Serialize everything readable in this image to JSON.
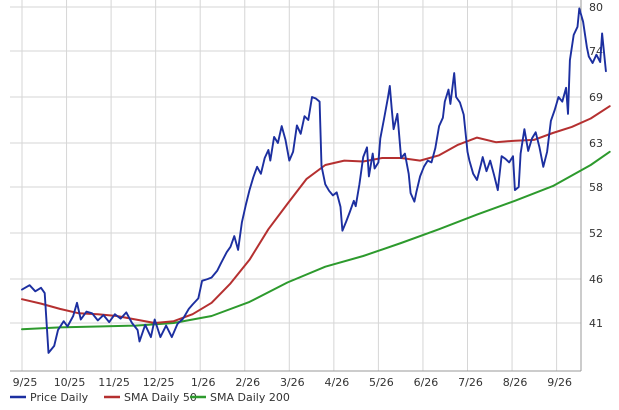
{
  "chart_data": {
    "type": "line",
    "x_ticks": [
      "9/25",
      "10/25",
      "11/25",
      "12/25",
      "1/26",
      "2/26",
      "3/26",
      "4/26",
      "5/26",
      "6/26",
      "7/26",
      "8/26",
      "9/26"
    ],
    "y_ticks": [
      80,
      74,
      69,
      63,
      58,
      52,
      46,
      41
    ],
    "ylim": [
      35,
      80
    ],
    "grid": true,
    "legend_position": "bottom-left",
    "series": [
      {
        "name": "Price Daily",
        "color": "#1c2fa0",
        "points": [
          [
            0,
            44.8
          ],
          [
            4,
            45.3
          ],
          [
            7,
            44.6
          ],
          [
            10,
            45.0
          ],
          [
            12,
            44.4
          ],
          [
            14,
            37.6
          ],
          [
            17,
            38.4
          ],
          [
            19,
            40.2
          ],
          [
            22,
            41.2
          ],
          [
            24,
            40.6
          ],
          [
            27,
            41.8
          ],
          [
            29,
            43.3
          ],
          [
            31,
            41.4
          ],
          [
            34,
            42.3
          ],
          [
            37,
            42.1
          ],
          [
            40,
            41.3
          ],
          [
            43,
            41.9
          ],
          [
            46,
            41.1
          ],
          [
            49,
            42.0
          ],
          [
            52,
            41.5
          ],
          [
            55,
            42.2
          ],
          [
            58,
            41.0
          ],
          [
            61,
            40.2
          ],
          [
            62,
            38.9
          ],
          [
            65,
            40.8
          ],
          [
            68,
            39.4
          ],
          [
            70,
            41.4
          ],
          [
            73,
            39.4
          ],
          [
            76,
            40.7
          ],
          [
            79,
            39.4
          ],
          [
            82,
            40.9
          ],
          [
            85,
            41.5
          ],
          [
            88,
            42.6
          ],
          [
            90,
            43.1
          ],
          [
            93,
            43.8
          ],
          [
            95,
            45.8
          ],
          [
            98,
            46.0
          ],
          [
            100,
            46.2
          ],
          [
            103,
            47.1
          ],
          [
            105,
            48.1
          ],
          [
            108,
            49.5
          ],
          [
            110,
            50.2
          ],
          [
            112,
            51.6
          ],
          [
            114,
            49.8
          ],
          [
            116,
            53.4
          ],
          [
            118,
            55.6
          ],
          [
            120,
            57.6
          ],
          [
            122,
            59.1
          ],
          [
            124,
            60.3
          ],
          [
            126,
            59.5
          ],
          [
            128,
            61.3
          ],
          [
            130,
            62.2
          ],
          [
            131,
            61.0
          ],
          [
            133,
            63.8
          ],
          [
            135,
            63.0
          ],
          [
            137,
            65.2
          ],
          [
            139,
            63.4
          ],
          [
            141,
            61.0
          ],
          [
            143,
            62.0
          ],
          [
            145,
            65.3
          ],
          [
            147,
            64.2
          ],
          [
            149,
            66.5
          ],
          [
            151,
            66.0
          ],
          [
            153,
            69.0
          ],
          [
            155,
            68.8
          ],
          [
            157,
            68.4
          ],
          [
            158,
            60.4
          ],
          [
            160,
            58.3
          ],
          [
            162,
            57.5
          ],
          [
            164,
            56.9
          ],
          [
            166,
            57.3
          ],
          [
            168,
            55.4
          ],
          [
            169,
            52.3
          ],
          [
            171,
            53.5
          ],
          [
            173,
            54.8
          ],
          [
            175,
            56.2
          ],
          [
            176,
            55.5
          ],
          [
            178,
            58.3
          ],
          [
            180,
            61.4
          ],
          [
            182,
            62.5
          ],
          [
            183,
            59.2
          ],
          [
            185,
            61.8
          ],
          [
            186,
            60.1
          ],
          [
            188,
            60.8
          ],
          [
            189,
            63.6
          ],
          [
            191,
            66.2
          ],
          [
            193,
            68.9
          ],
          [
            194,
            70.2
          ],
          [
            195,
            67.5
          ],
          [
            196,
            64.8
          ],
          [
            198,
            66.8
          ],
          [
            200,
            61.3
          ],
          [
            202,
            61.8
          ],
          [
            204,
            59.5
          ],
          [
            205,
            57.2
          ],
          [
            207,
            56.1
          ],
          [
            208,
            57.3
          ],
          [
            210,
            59.2
          ],
          [
            212,
            60.3
          ],
          [
            214,
            61.0
          ],
          [
            216,
            60.8
          ],
          [
            218,
            62.4
          ],
          [
            220,
            65.2
          ],
          [
            222,
            66.3
          ],
          [
            223,
            68.4
          ],
          [
            225,
            69.8
          ],
          [
            226,
            68.1
          ],
          [
            228,
            71.6
          ],
          [
            229,
            69.0
          ],
          [
            231,
            68.3
          ],
          [
            233,
            66.7
          ],
          [
            235,
            62.0
          ],
          [
            236,
            61.0
          ],
          [
            238,
            59.5
          ],
          [
            240,
            58.8
          ],
          [
            242,
            60.5
          ],
          [
            243,
            61.4
          ],
          [
            245,
            59.8
          ],
          [
            247,
            61.0
          ],
          [
            249,
            59.4
          ],
          [
            251,
            57.6
          ],
          [
            253,
            61.5
          ],
          [
            255,
            61.2
          ],
          [
            257,
            60.8
          ],
          [
            259,
            61.5
          ],
          [
            260,
            57.6
          ],
          [
            262,
            58.0
          ],
          [
            263,
            61.8
          ],
          [
            265,
            64.8
          ],
          [
            267,
            62.1
          ],
          [
            269,
            63.6
          ],
          [
            271,
            64.4
          ],
          [
            273,
            62.5
          ],
          [
            275,
            60.3
          ],
          [
            277,
            62.0
          ],
          [
            279,
            65.9
          ],
          [
            281,
            67.3
          ],
          [
            283,
            69.0
          ],
          [
            285,
            68.4
          ],
          [
            287,
            70.0
          ],
          [
            288,
            66.8
          ],
          [
            289,
            73.0
          ],
          [
            291,
            76.2
          ],
          [
            293,
            77.3
          ],
          [
            294,
            79.8
          ],
          [
            296,
            78.0
          ],
          [
            298,
            74.5
          ],
          [
            299,
            73.4
          ],
          [
            301,
            72.7
          ],
          [
            303,
            73.6
          ],
          [
            305,
            72.8
          ],
          [
            306,
            76.4
          ],
          [
            308,
            71.8
          ]
        ]
      },
      {
        "name": "SMA Daily 50",
        "color": "#b53030",
        "points": [
          [
            0,
            43.7
          ],
          [
            10,
            43.2
          ],
          [
            20,
            42.6
          ],
          [
            30,
            42.1
          ],
          [
            40,
            42.0
          ],
          [
            50,
            41.8
          ],
          [
            60,
            41.4
          ],
          [
            70,
            41.0
          ],
          [
            80,
            41.2
          ],
          [
            90,
            42.0
          ],
          [
            100,
            43.3
          ],
          [
            110,
            45.5
          ],
          [
            120,
            48.5
          ],
          [
            130,
            52.5
          ],
          [
            140,
            55.8
          ],
          [
            150,
            58.9
          ],
          [
            160,
            60.5
          ],
          [
            170,
            61.0
          ],
          [
            180,
            60.9
          ],
          [
            190,
            61.3
          ],
          [
            200,
            61.3
          ],
          [
            210,
            61.0
          ],
          [
            220,
            61.6
          ],
          [
            230,
            62.8
          ],
          [
            240,
            63.7
          ],
          [
            250,
            63.1
          ],
          [
            260,
            63.3
          ],
          [
            270,
            63.4
          ],
          [
            280,
            64.3
          ],
          [
            290,
            65.1
          ],
          [
            300,
            66.2
          ],
          [
            310,
            67.8
          ]
        ]
      },
      {
        "name": "SMA Daily 200",
        "color": "#2d9a2d",
        "points": [
          [
            0,
            40.3
          ],
          [
            20,
            40.5
          ],
          [
            40,
            40.6
          ],
          [
            60,
            40.7
          ],
          [
            80,
            41.0
          ],
          [
            100,
            41.8
          ],
          [
            120,
            43.4
          ],
          [
            140,
            45.6
          ],
          [
            160,
            47.6
          ],
          [
            180,
            49.0
          ],
          [
            200,
            50.7
          ],
          [
            220,
            52.5
          ],
          [
            240,
            54.4
          ],
          [
            260,
            56.2
          ],
          [
            280,
            58.1
          ],
          [
            300,
            60.5
          ],
          [
            310,
            62.0
          ]
        ]
      }
    ]
  }
}
